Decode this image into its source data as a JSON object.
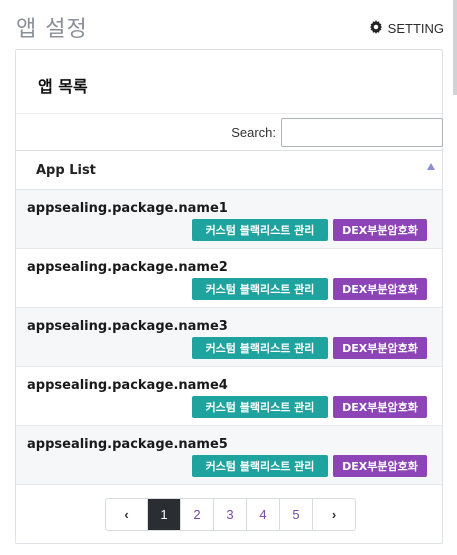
{
  "header": {
    "title": "앱 설정",
    "setting_label": "SETTING"
  },
  "card": {
    "title": "앱 목록",
    "search_label": "Search:",
    "search_value": "",
    "column_header": "App List",
    "rows": [
      {
        "package": "appsealing.package.name1",
        "blacklist_label": "커스텀 블랙리스트 관리",
        "dex_label": "DEX부분암호화"
      },
      {
        "package": "appsealing.package.name2",
        "blacklist_label": "커스텀 블랙리스트 관리",
        "dex_label": "DEX부분암호화"
      },
      {
        "package": "appsealing.package.name3",
        "blacklist_label": "커스텀 블랙리스트 관리",
        "dex_label": "DEX부분암호화"
      },
      {
        "package": "appsealing.package.name4",
        "blacklist_label": "커스텀 블랙리스트 관리",
        "dex_label": "DEX부분암호화"
      },
      {
        "package": "appsealing.package.name5",
        "blacklist_label": "커스텀 블랙리스트 관리",
        "dex_label": "DEX부분암호화"
      }
    ]
  },
  "pagination": {
    "prev": "‹",
    "next": "›",
    "pages": [
      "1",
      "2",
      "3",
      "4",
      "5"
    ],
    "current_page": "1"
  },
  "colors": {
    "teal_button": "#1fa39e",
    "purple_button": "#8c44b6",
    "active_page": "#2a2d31",
    "page_link": "#7a49a8"
  },
  "icons": {
    "setting": "gear-icon",
    "sort": "sort-asc-icon"
  }
}
